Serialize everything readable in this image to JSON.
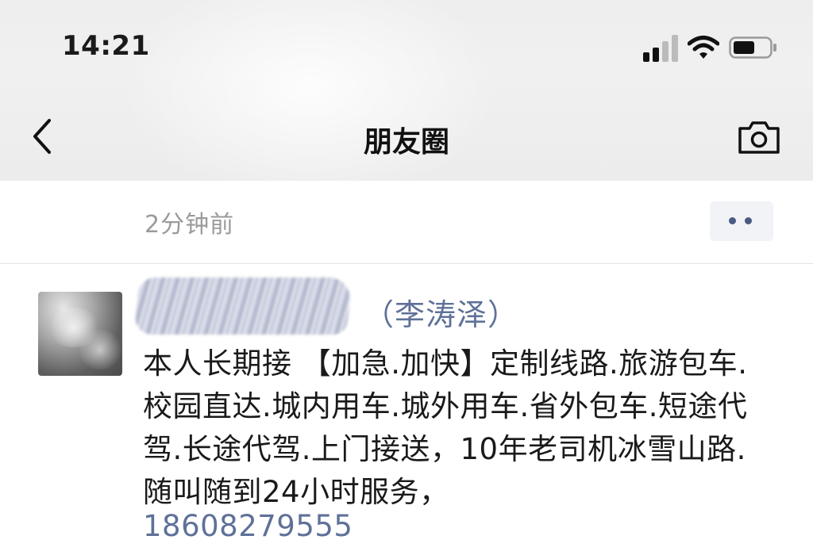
{
  "status_bar": {
    "time": "14:21"
  },
  "nav": {
    "title": "朋友圈"
  },
  "post": {
    "time": "2分钟前"
  },
  "comment": {
    "remark": "（李涛泽）",
    "body": "本人长期接 【加急.加快】定制线路.旅游包车.校园直达.城内用车.城外用车.省外包车.短途代驾.长途代驾.上门接送，10年老司机冰雪山路.随叫随到24小时服务，",
    "phone": "18608279555"
  },
  "icons": {
    "back": "chevron-left-icon",
    "camera": "camera-icon",
    "more": "more-dots-icon",
    "signal": "cellular-signal-icon",
    "wifi": "wifi-icon",
    "battery": "battery-icon"
  },
  "colors": {
    "link": "#5f7198",
    "meta_text": "#9a9a9a",
    "more_button_bg": "#f2f3f6"
  }
}
